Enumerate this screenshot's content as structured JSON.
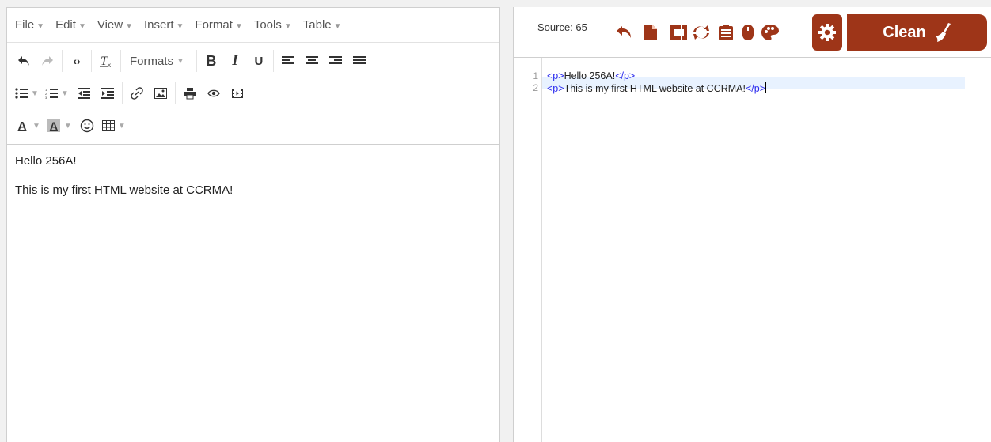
{
  "editor": {
    "menus": [
      "File",
      "Edit",
      "View",
      "Insert",
      "Format",
      "Tools",
      "Table"
    ],
    "formats_label": "Formats",
    "content": [
      "Hello 256A!",
      "This is my first HTML website at CCRMA!"
    ]
  },
  "source": {
    "count_label": "Source: 65",
    "clean_label": "Clean",
    "accent_color": "#9e3518",
    "lines": [
      {
        "num": "1",
        "open": "<p>",
        "text": "Hello 256A!",
        "close": "</p>"
      },
      {
        "num": "2",
        "open": "<p>",
        "text": "This is my first HTML website at CCRMA!",
        "close": "</p>"
      }
    ]
  }
}
